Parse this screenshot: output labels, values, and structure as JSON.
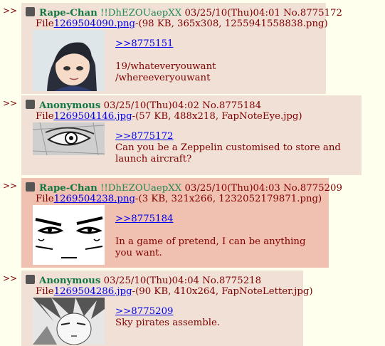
{
  "posts": [
    {
      "arrow": ">>",
      "name": "Rape-Chan",
      "trip": "!!DhEZOUaepXX",
      "date": "03/25/10(Thu)04:01",
      "no": "No.8775172",
      "file_prefix": "File",
      "file_link": "1269504090.png",
      "file_meta": "-(98 KB, 365x308, 1255941558838.png)",
      "quote": ">>8775151",
      "lines": [
        "19/whateveryouwant",
        "/whereeveryouwant"
      ]
    },
    {
      "arrow": ">>",
      "name": "Anonymous",
      "trip": "",
      "date": "03/25/10(Thu)04:02",
      "no": "No.8775184",
      "file_prefix": "File",
      "file_link": "1269504146.jpg",
      "file_meta": "-(57 KB, 488x218, FapNoteEye.jpg)",
      "quote": ">>8775172",
      "lines": [
        "Can you be a Zeppelin customised to store and",
        "launch aircraft?"
      ]
    },
    {
      "arrow": ">>",
      "name": "Rape-Chan",
      "trip": "!!DhEZOUaepXX",
      "date": "03/25/10(Thu)04:03",
      "no": "No.8775209",
      "file_prefix": "File",
      "file_link": "1269504238.png",
      "file_meta": "-(3 KB, 321x266, 1232052179871.png)",
      "quote": ">>8775184",
      "lines": [
        "In a game of pretend, I can be anything",
        "you want."
      ]
    },
    {
      "arrow": ">>",
      "name": "Anonymous",
      "trip": "",
      "date": "03/25/10(Thu)04:04",
      "no": "No.8775218",
      "file_prefix": "File",
      "file_link": "1269504286.jpg",
      "file_meta": "-(90 KB, 410x264, FapNoteLetter.jpg)",
      "quote": ">>8775209",
      "lines": [
        "Sky pirates assemble."
      ]
    }
  ]
}
